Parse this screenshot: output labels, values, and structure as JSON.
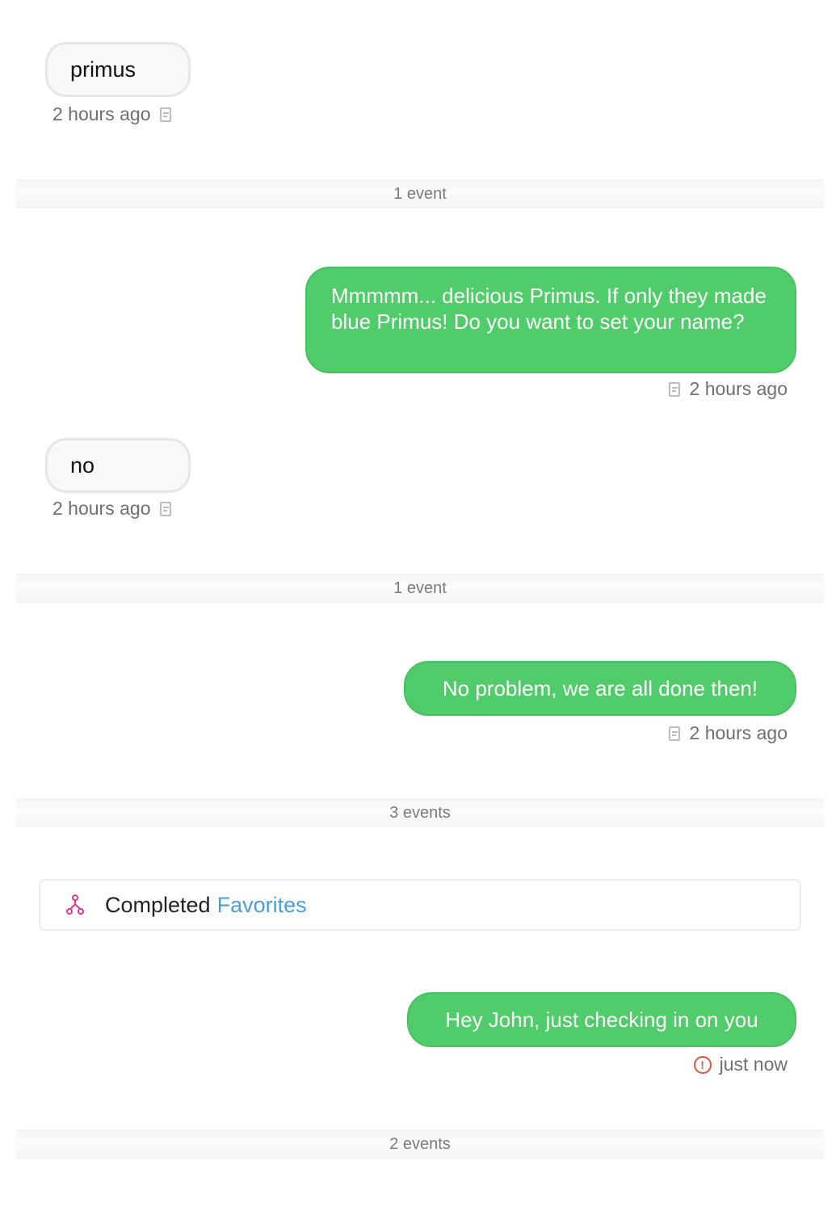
{
  "messages": [
    {
      "text": "primus",
      "time": "2 hours ago"
    },
    {
      "text": "Mmmmm... delicious Primus. If only they made blue Primus! Do you want to set your name?",
      "time": "2 hours ago"
    },
    {
      "text": "no",
      "time": "2 hours ago"
    },
    {
      "text": "No problem, we are all done then!",
      "time": "2 hours ago"
    },
    {
      "text": "Hey John, just checking in on you",
      "time": "just now"
    }
  ],
  "separators": [
    "1 event",
    "1 event",
    "3 events",
    "2 events"
  ],
  "flow_event": {
    "icon": "flow-icon",
    "label": "Completed",
    "link": "Favorites"
  },
  "colors": {
    "outgoing_bubble": "#51cc6a",
    "incoming_bubble": "#f8f8f8",
    "link": "#4a9fd8",
    "flow_icon": "#e0368f",
    "error": "#e5533d"
  }
}
